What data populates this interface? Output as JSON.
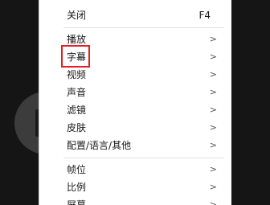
{
  "menu": {
    "items": [
      {
        "label": "关闭",
        "shortcut": "F4",
        "arrow": ""
      },
      {
        "label": "播放",
        "shortcut": "",
        "arrow": ">"
      },
      {
        "label": "字幕",
        "shortcut": "",
        "arrow": ">"
      },
      {
        "label": "视频",
        "shortcut": "",
        "arrow": ">"
      },
      {
        "label": "声音",
        "shortcut": "",
        "arrow": ">"
      },
      {
        "label": "滤镜",
        "shortcut": "",
        "arrow": ">"
      },
      {
        "label": "皮肤",
        "shortcut": "",
        "arrow": ">"
      },
      {
        "label": "配置/语言/其他",
        "shortcut": "",
        "arrow": ">"
      },
      {
        "label": "帧位",
        "shortcut": "",
        "arrow": ">"
      },
      {
        "label": "比例",
        "shortcut": "",
        "arrow": ">"
      },
      {
        "label": "屏幕",
        "shortcut": "",
        "arrow": ">"
      }
    ]
  },
  "colors": {
    "highlight": "#e01f26",
    "menu_background": "#ffffff",
    "backdrop": "#151515"
  }
}
